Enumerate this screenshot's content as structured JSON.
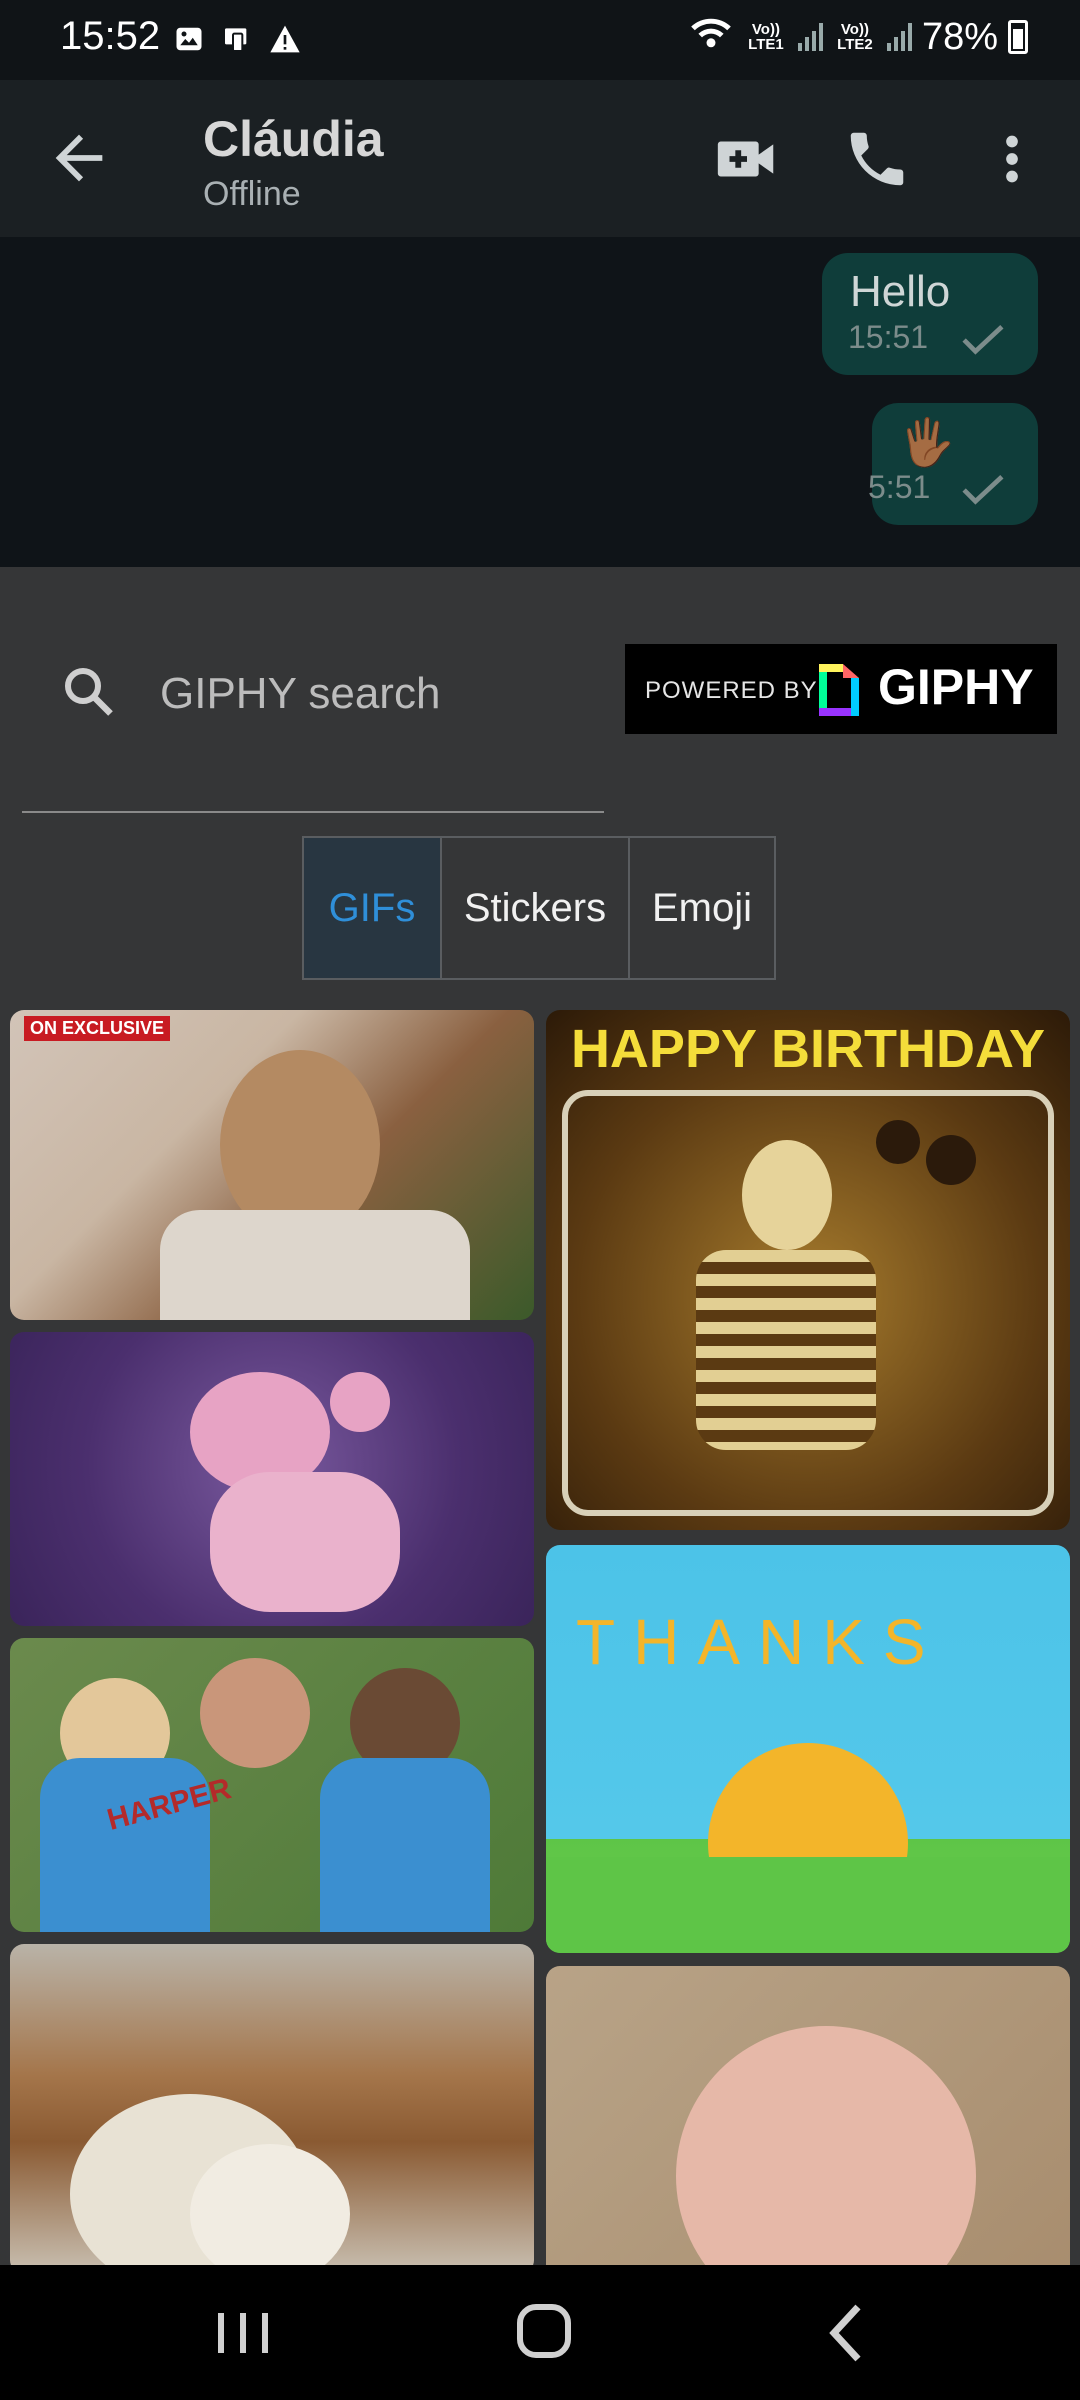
{
  "status_bar": {
    "time": "15:52",
    "battery": "78%",
    "sim1_label": "Vo)) LTE1",
    "sim2_label": "Vo)) LTE2"
  },
  "header": {
    "contact_name": "Cláudia",
    "contact_status": "Offline"
  },
  "messages": [
    {
      "text": "Hello",
      "time": "15:51",
      "status": "sent"
    },
    {
      "text": "🖐🏾",
      "time": "5:51",
      "status": "sent"
    }
  ],
  "giphy": {
    "search_placeholder": "GIPHY search",
    "search_value": "",
    "powered_by": "POWERED BY",
    "brand": "GIPHY",
    "tabs": [
      {
        "label": "GIFs",
        "selected": true
      },
      {
        "label": "Stickers",
        "selected": false
      },
      {
        "label": "Emoji",
        "selected": false
      }
    ],
    "gifs": [
      {
        "name": "gif-phone-call",
        "caption": "ON EXCLUSIVE"
      },
      {
        "name": "gif-happy-birthday-skeleton",
        "caption": "HAPPY BIRTHDAY"
      },
      {
        "name": "gif-pink-character"
      },
      {
        "name": "gif-harper-kids",
        "caption": "HARPER"
      },
      {
        "name": "gif-thanks-sun",
        "caption": "THANKS"
      },
      {
        "name": "gif-teddy-bear"
      },
      {
        "name": "gif-crying-baby"
      }
    ]
  },
  "colors": {
    "accent": "#2f8fd9",
    "bubble": "#0f3d3a",
    "panel": "#353637",
    "appbar": "#1b2023"
  }
}
